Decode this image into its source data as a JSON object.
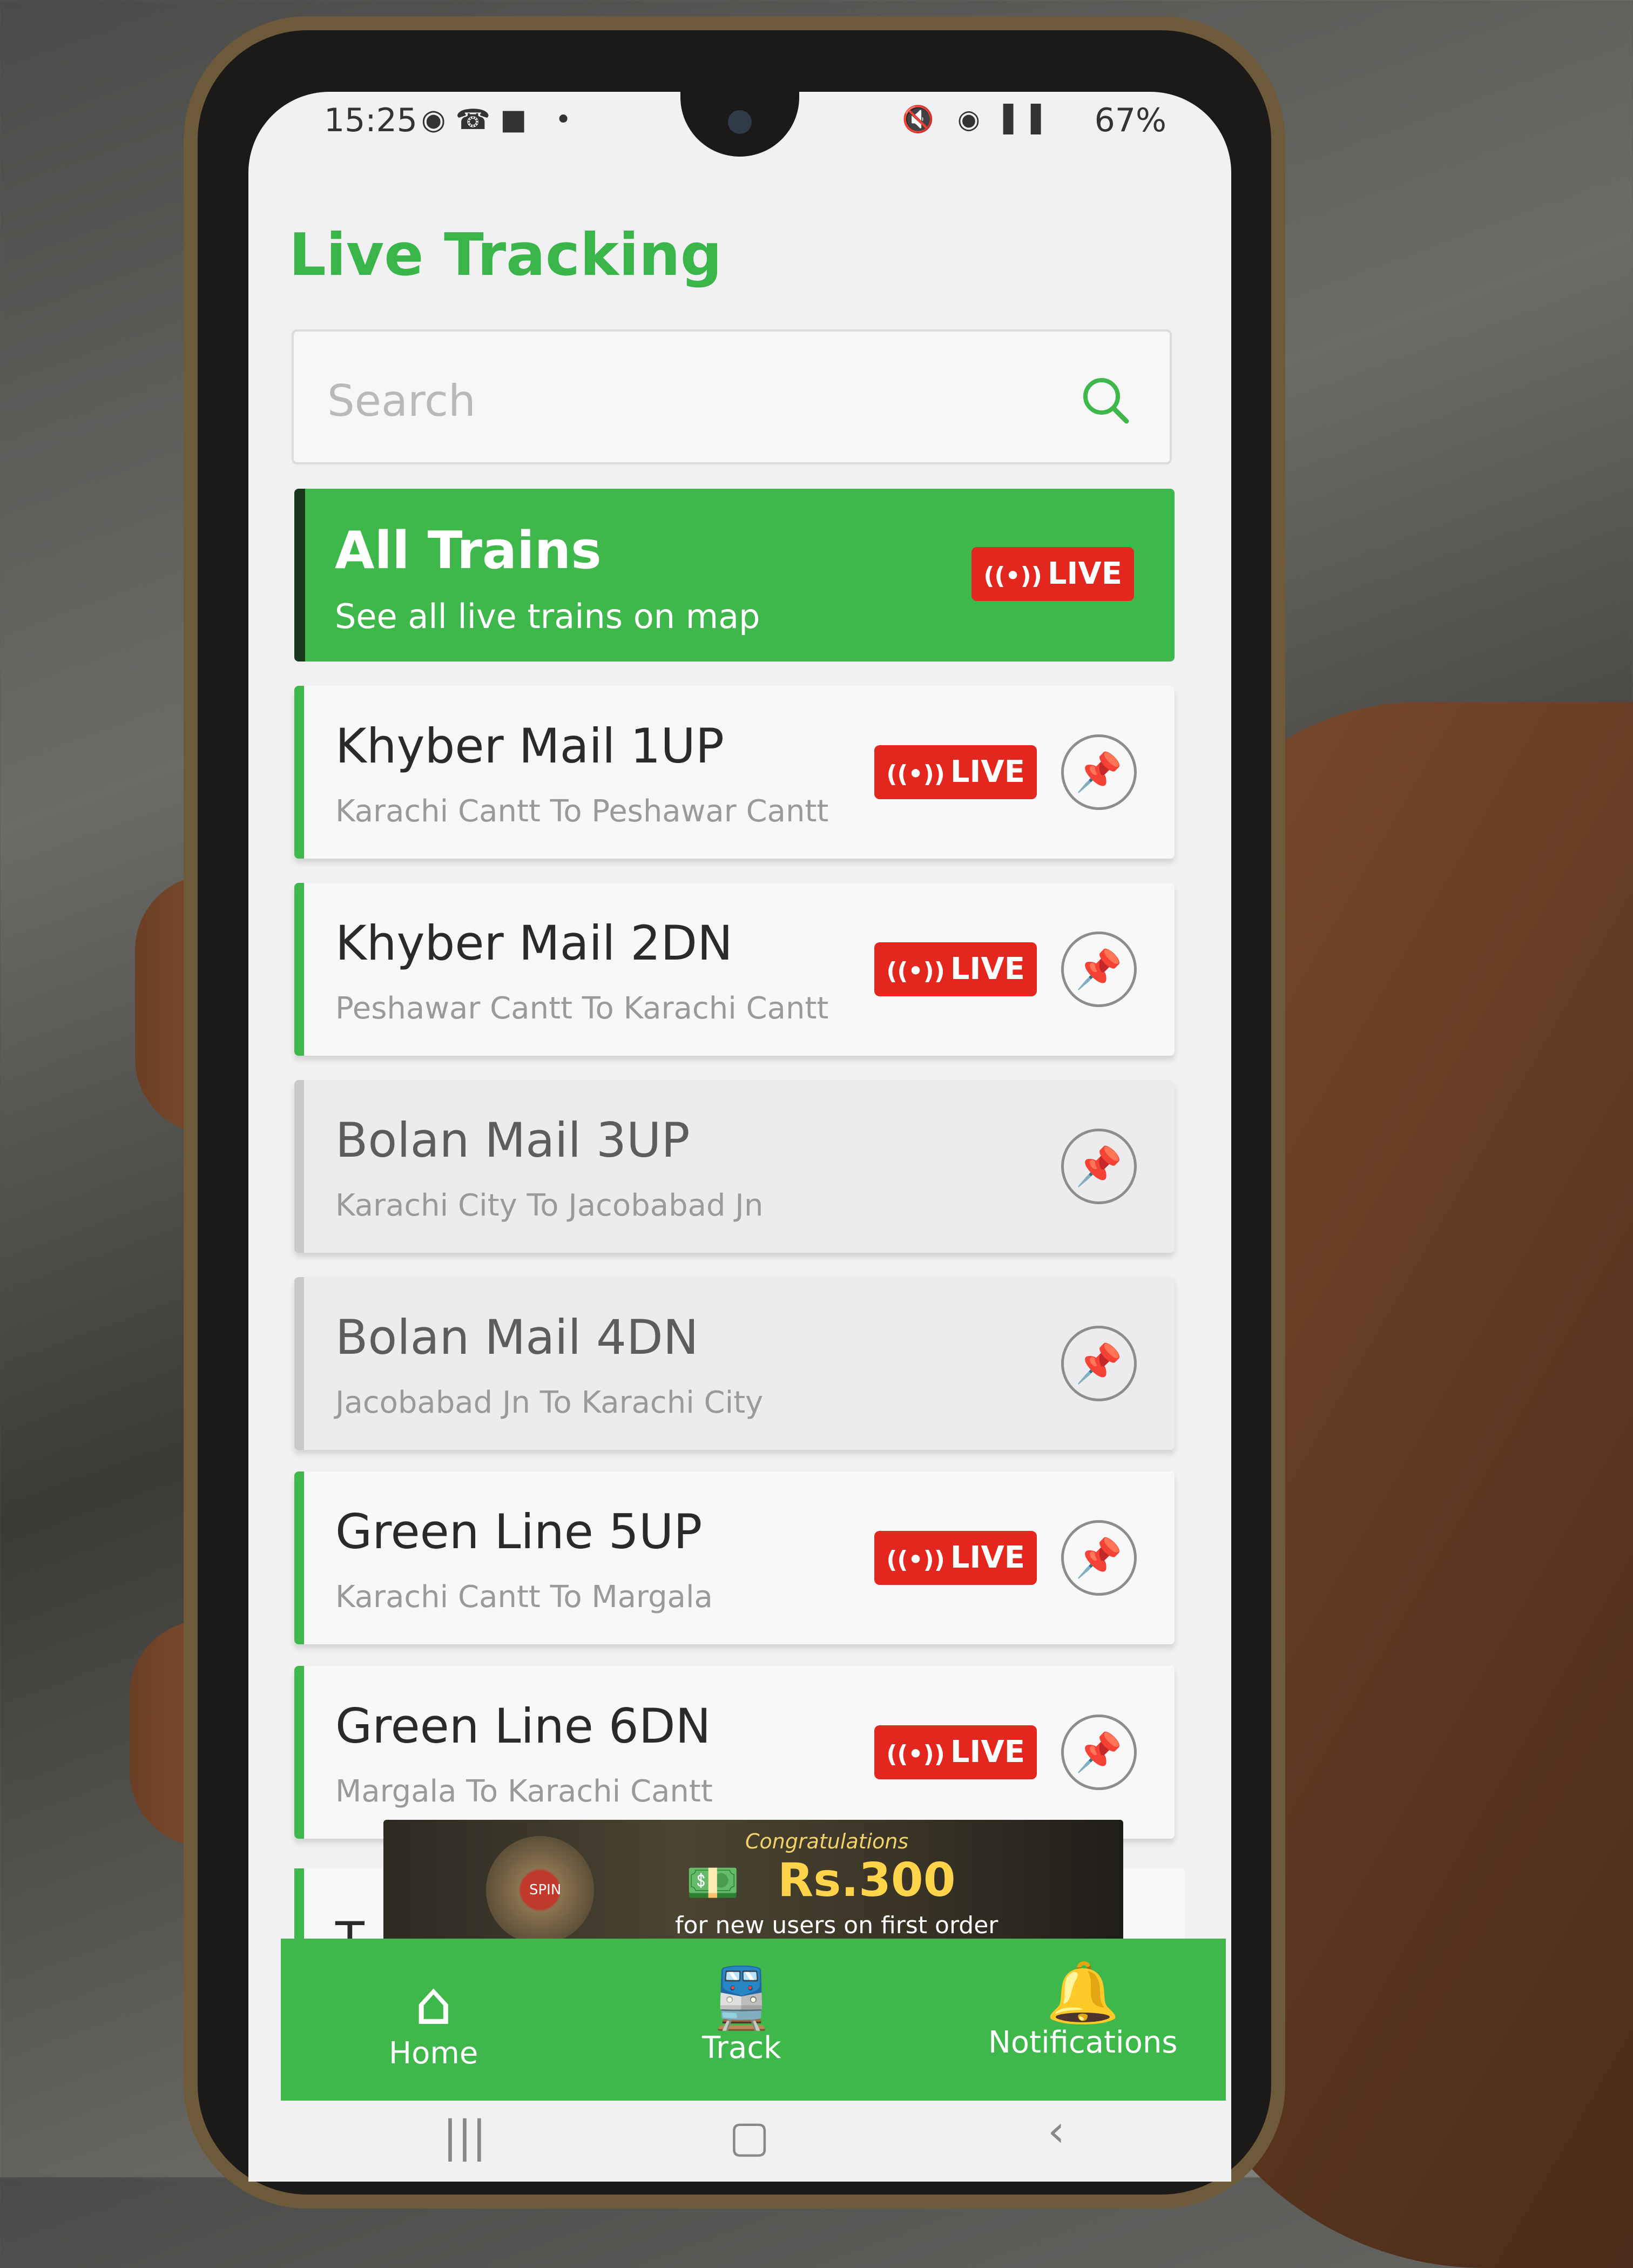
{
  "status_bar": {
    "time": "15:25",
    "left_icons": "◉☎■ •",
    "right_icons": "🔇 ◉ ▌▌",
    "battery": "67%"
  },
  "header": {
    "title": "Live Tracking"
  },
  "search": {
    "placeholder": "Search"
  },
  "all_trains": {
    "title": "All Trains",
    "subtitle": "See all live trains on map",
    "badge": "LIVE"
  },
  "trains": [
    {
      "name": "Khyber Mail 1UP",
      "route": "Karachi Cantt To Peshawar Cantt",
      "live": "LIVE"
    },
    {
      "name": "Khyber Mail 2DN",
      "route": "Peshawar Cantt To Karachi Cantt",
      "live": "LIVE"
    },
    {
      "name": "Bolan Mail 3UP",
      "route": "Karachi City To Jacobabad Jn",
      "live": ""
    },
    {
      "name": "Bolan Mail 4DN",
      "route": "Jacobabad Jn To Karachi City",
      "live": ""
    },
    {
      "name": "Green Line 5UP",
      "route": "Karachi Cantt To Margala",
      "live": "LIVE"
    },
    {
      "name": "Green Line 6DN",
      "route": "Margala To Karachi Cantt",
      "live": "LIVE"
    }
  ],
  "partial_next": "T",
  "ad": {
    "congratulations": "Congratulations",
    "amount": "Rs.300",
    "note": "for new users on first order",
    "spin": "SPIN"
  },
  "nav": [
    {
      "label": "Home",
      "icon": "home-icon"
    },
    {
      "label": "Track",
      "icon": "train-icon"
    },
    {
      "label": "Notifications",
      "icon": "bell-icon"
    }
  ],
  "system_nav": {
    "recents": "|||",
    "home": "▢",
    "back": "‹"
  },
  "colors": {
    "accent": "#3fb84b",
    "live": "#e3261e",
    "title": "#3ab54a"
  }
}
